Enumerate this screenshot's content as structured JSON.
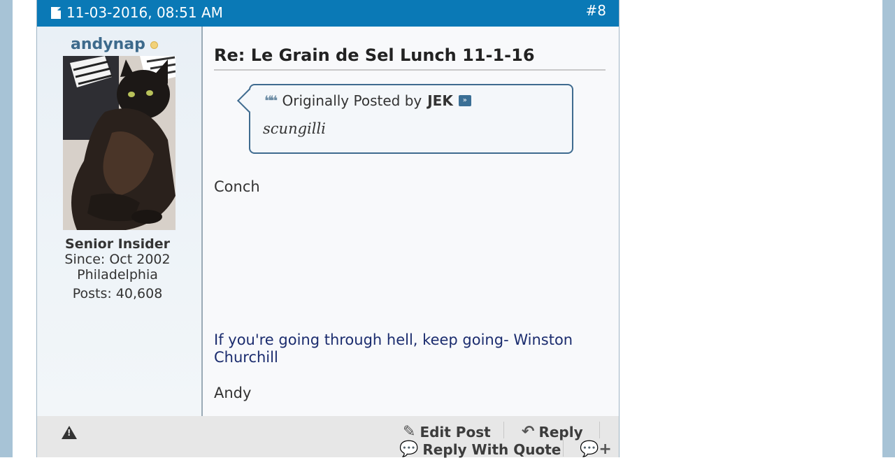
{
  "post": {
    "date": "11-03-2016, 08:51 AM",
    "number": "#8",
    "title": "Re: Le Grain de Sel Lunch 11-1-16",
    "body": "Conch",
    "signature": "If you're going through hell, keep going- Winston Churchill",
    "closing": "Andy"
  },
  "user": {
    "name": "andynap",
    "title": "Senior Insider",
    "since": "Since: Oct 2002",
    "location": "Philadelphia",
    "posts": "Posts: 40,608"
  },
  "quote": {
    "prefix": "Originally Posted by",
    "author": "JEK",
    "text": "scungilli"
  },
  "actions": {
    "edit": "Edit Post",
    "reply": "Reply",
    "reply_quote": "Reply With Quote"
  },
  "icons": {
    "post": "document-icon",
    "quote": "quote-icon",
    "goto": "goto-post-icon",
    "report": "warning-icon",
    "edit": "pencil-icon",
    "reply": "reply-arrow-icon",
    "reply_quote": "speech-bubble-quote-icon",
    "multiquote": "multiquote-plus-icon"
  },
  "colors": {
    "header": "#0a79b6",
    "username": "#3d6a8c",
    "signature": "#1b2c6e",
    "quote_border": "#3f6b8f"
  }
}
